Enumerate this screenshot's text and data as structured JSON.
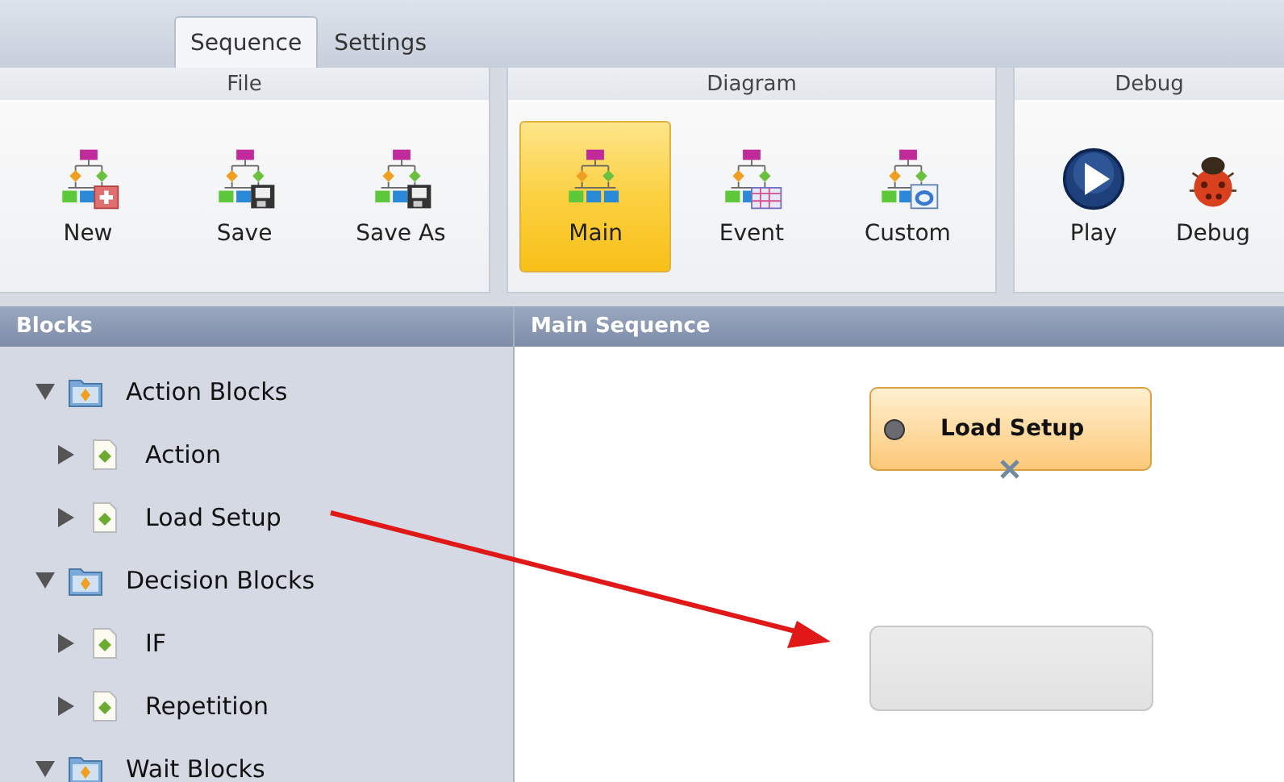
{
  "tabs": [
    {
      "label": "Sequence",
      "selected": true
    },
    {
      "label": "Settings",
      "selected": false
    }
  ],
  "ribbon_groups": [
    {
      "title": "File",
      "buttons": [
        {
          "label": "New",
          "kind": "new",
          "selected": false
        },
        {
          "label": "Save",
          "kind": "save",
          "selected": false
        },
        {
          "label": "Save As",
          "kind": "save",
          "selected": false
        }
      ]
    },
    {
      "title": "Diagram",
      "buttons": [
        {
          "label": "Main",
          "kind": "flowchart",
          "selected": true
        },
        {
          "label": "Event",
          "kind": "event",
          "selected": false
        },
        {
          "label": "Custom",
          "kind": "custom",
          "selected": false
        }
      ]
    },
    {
      "title": "Debug",
      "buttons": [
        {
          "label": "Play",
          "kind": "play",
          "selected": false
        },
        {
          "label": "Debug",
          "kind": "bug",
          "selected": false
        }
      ]
    }
  ],
  "sidebar": {
    "title": "Blocks",
    "items": [
      {
        "label": "Action Blocks",
        "kind": "folder",
        "expanded": true,
        "children": [
          {
            "label": "Action",
            "kind": "block",
            "expanded": false
          },
          {
            "label": "Load Setup",
            "kind": "block",
            "expanded": false
          }
        ]
      },
      {
        "label": "Decision Blocks",
        "kind": "folder",
        "expanded": true,
        "children": [
          {
            "label": "IF",
            "kind": "block",
            "expanded": false
          },
          {
            "label": "Repetition",
            "kind": "block",
            "expanded": false
          }
        ]
      },
      {
        "label": "Wait Blocks",
        "kind": "folder",
        "expanded": true
      }
    ]
  },
  "canvas": {
    "title": "Main Sequence",
    "nodes": [
      {
        "kind": "block",
        "label": "Load Setup"
      },
      {
        "kind": "drop-target"
      }
    ]
  }
}
